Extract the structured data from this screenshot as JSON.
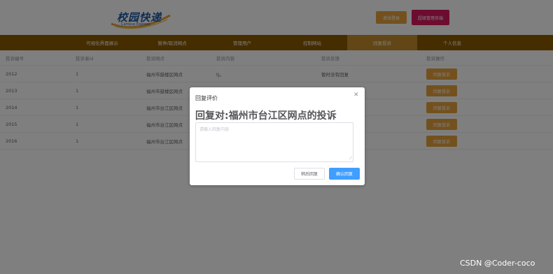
{
  "header": {
    "logo_text": "校园快递",
    "logo_sub": "Campus Express",
    "logout_label": "退出登录",
    "admin_label": "超级管理员端"
  },
  "nav": {
    "items": [
      {
        "label": "可视化界面展示"
      },
      {
        "label": "暂停/取消网点"
      },
      {
        "label": "管理用户"
      },
      {
        "label": "控制网站"
      },
      {
        "label": "回复投诉"
      },
      {
        "label": "个人信息"
      }
    ],
    "active_index": 4
  },
  "table": {
    "headers": [
      "投诉编号",
      "投诉者id",
      "投诉网点",
      "投诉内容",
      "投诉反馈",
      "投诉操作"
    ],
    "rows": [
      {
        "id": "2012",
        "user": "1",
        "branch": "福州市鼓楼区网点",
        "content": "tj。",
        "feedback": "暂时没有回复",
        "action": "回复投诉"
      },
      {
        "id": "2013",
        "user": "1",
        "branch": "福州市鼓楼区网点",
        "content": "",
        "feedback": "",
        "action": "回复投诉"
      },
      {
        "id": "2014",
        "user": "1",
        "branch": "福州市台江区网点",
        "content": "",
        "feedback": "",
        "action": "回复投诉"
      },
      {
        "id": "2015",
        "user": "1",
        "branch": "福州市台江区网点",
        "content": "",
        "feedback": "",
        "action": "回复投诉"
      },
      {
        "id": "2016",
        "user": "1",
        "branch": "福州市台江区网点",
        "content": "",
        "feedback": "",
        "action": "回复投诉"
      }
    ]
  },
  "dialog": {
    "title": "回复评价",
    "close_icon": "close-icon",
    "heading": "回复对:福州市台江区网点的投诉",
    "textarea_placeholder": "请输入回复内容",
    "later_label": "稍后回复",
    "confirm_label": "确认回复"
  },
  "watermark": "CSDN @Coder-coco",
  "colors": {
    "nav_bg": "#8a5a00",
    "nav_active": "#c58d2a",
    "warning": "#e6a23c",
    "admin": "#d81b60",
    "primary": "#409eff"
  }
}
